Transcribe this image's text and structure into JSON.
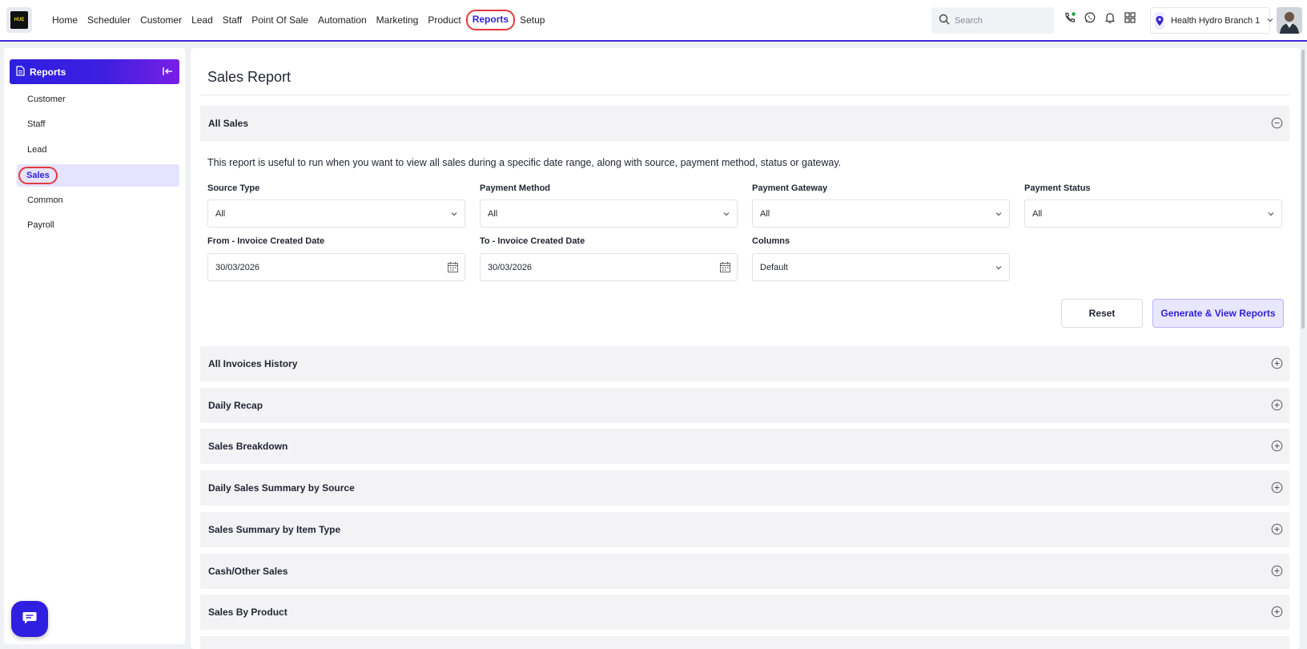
{
  "topnav": {
    "logo_text": "HUE",
    "items": [
      "Home",
      "Scheduler",
      "Customer",
      "Lead",
      "Staff",
      "Point Of Sale",
      "Automation",
      "Marketing",
      "Product",
      "Reports",
      "Setup"
    ],
    "active": "Reports",
    "search_placeholder": "Search",
    "branch": "Health Hydro Branch 1",
    "icons": [
      "phone-call-icon",
      "whatsapp-icon",
      "bell-icon",
      "grid-icon"
    ]
  },
  "sidebar": {
    "title": "Reports",
    "items": [
      "Customer",
      "Staff",
      "Lead",
      "Sales",
      "Common",
      "Payroll"
    ],
    "active": "Sales"
  },
  "main": {
    "page_title": "Sales Report",
    "expanded_section": {
      "title": "All Sales",
      "description": "This report is useful to run when you want to view all sales during a specific date range, along with source, payment method, status or gateway.",
      "fields": {
        "source_type": {
          "label": "Source Type",
          "value": "All"
        },
        "payment_method": {
          "label": "Payment Method",
          "value": "All"
        },
        "payment_gateway": {
          "label": "Payment Gateway",
          "value": "All"
        },
        "payment_status": {
          "label": "Payment Status",
          "value": "All"
        },
        "from_date": {
          "label": "From - Invoice Created Date",
          "value": "30/03/2026"
        },
        "to_date": {
          "label": "To - Invoice Created Date",
          "value": "30/03/2026"
        },
        "columns": {
          "label": "Columns",
          "value": "Default"
        }
      },
      "reset_label": "Reset",
      "generate_label": "Generate & View Reports"
    },
    "collapsed_sections": [
      "All Invoices History",
      "Daily Recap",
      "Sales Breakdown",
      "Daily Sales Summary by Source",
      "Sales Summary by Item Type",
      "Cash/Other Sales",
      "Sales By Product"
    ]
  },
  "colors": {
    "accent": "#2f1fd6",
    "highlight_ring": "#e23b3b",
    "panel": "#f3f3f6"
  }
}
